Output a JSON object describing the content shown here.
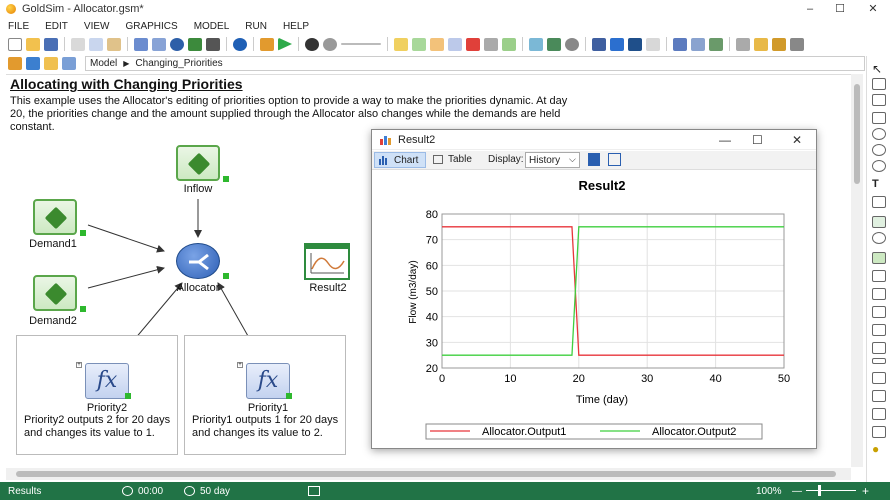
{
  "window": {
    "title": "GoldSim - Allocator.gsm*",
    "minimize": "–",
    "maximize": "☐",
    "close": "✕"
  },
  "menu": [
    "FILE",
    "EDIT",
    "VIEW",
    "GRAPHICS",
    "MODEL",
    "RUN",
    "HELP"
  ],
  "breadcrumb": {
    "root": "Model",
    "current": "Changing_Priorities"
  },
  "document": {
    "title": "Allocating with Changing Priorities",
    "description": "This example uses the Allocator's editing of priorities option to provide a way to make the priorities dynamic. At day 20, the priorities change and the amount supplied through the Allocator also changes while the demands are held constant."
  },
  "elements": {
    "inflow": "Inflow",
    "demand1": "Demand1",
    "demand2": "Demand2",
    "allocator": "Allocator",
    "result2": "Result2",
    "priority2": "Priority2",
    "priority1": "Priority1",
    "fx_symbol": "fx"
  },
  "notes": {
    "priority2": "Priority2 outputs 2 for 20 days and changes its value to 1.",
    "priority1": "Priority1 outputs 1 for 20 days and changes its value to 2."
  },
  "result_window": {
    "title": "Result2",
    "tab_chart": "Chart",
    "tab_table": "Table",
    "display_label": "Display:",
    "display_value": "History",
    "minimize": "—",
    "maximize": "☐",
    "close": "✕"
  },
  "chart_data": {
    "type": "line",
    "title": "Result2",
    "xlabel": "Time (day)",
    "ylabel": "Flow (m3/day)",
    "xlim": [
      0,
      50
    ],
    "ylim": [
      20,
      80
    ],
    "xticks": [
      0,
      10,
      20,
      30,
      40,
      50
    ],
    "yticks": [
      20,
      30,
      40,
      50,
      60,
      70,
      80
    ],
    "grid": true,
    "legend": "bottom",
    "series": [
      {
        "name": "Allocator.Output1",
        "color": "#e8353b",
        "x": [
          0,
          19,
          20,
          50
        ],
        "y": [
          75,
          75,
          25,
          25
        ]
      },
      {
        "name": "Allocator.Output2",
        "color": "#3fcf3f",
        "x": [
          0,
          19,
          20,
          50
        ],
        "y": [
          25,
          25,
          75,
          75
        ]
      }
    ]
  },
  "status": {
    "mode": "Results",
    "clock": "00:00",
    "duration": "50 day",
    "zoom": "100%",
    "minus": "—",
    "plus": "+"
  }
}
